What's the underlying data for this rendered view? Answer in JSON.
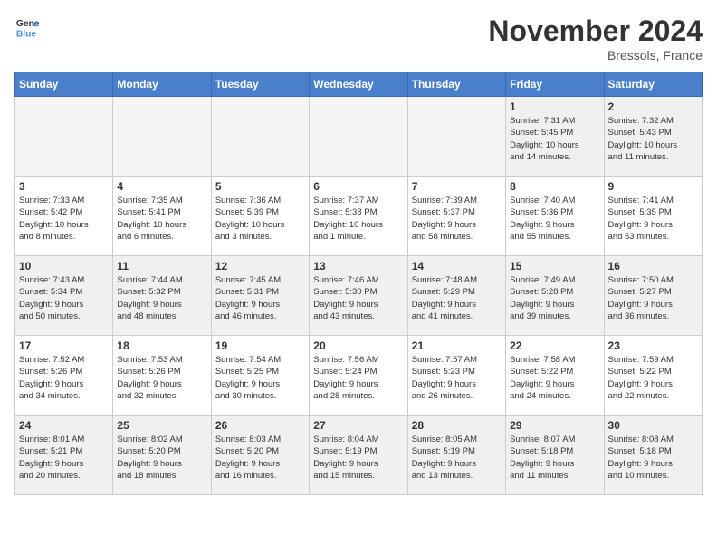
{
  "header": {
    "logo_line1": "General",
    "logo_line2": "Blue",
    "month": "November 2024",
    "location": "Bressols, France"
  },
  "days_of_week": [
    "Sunday",
    "Monday",
    "Tuesday",
    "Wednesday",
    "Thursday",
    "Friday",
    "Saturday"
  ],
  "weeks": [
    [
      {
        "num": "",
        "info": "",
        "empty": true
      },
      {
        "num": "",
        "info": "",
        "empty": true
      },
      {
        "num": "",
        "info": "",
        "empty": true
      },
      {
        "num": "",
        "info": "",
        "empty": true
      },
      {
        "num": "",
        "info": "",
        "empty": true
      },
      {
        "num": "1",
        "info": "Sunrise: 7:31 AM\nSunset: 5:45 PM\nDaylight: 10 hours\nand 14 minutes."
      },
      {
        "num": "2",
        "info": "Sunrise: 7:32 AM\nSunset: 5:43 PM\nDaylight: 10 hours\nand 11 minutes."
      }
    ],
    [
      {
        "num": "3",
        "info": "Sunrise: 7:33 AM\nSunset: 5:42 PM\nDaylight: 10 hours\nand 8 minutes."
      },
      {
        "num": "4",
        "info": "Sunrise: 7:35 AM\nSunset: 5:41 PM\nDaylight: 10 hours\nand 6 minutes."
      },
      {
        "num": "5",
        "info": "Sunrise: 7:36 AM\nSunset: 5:39 PM\nDaylight: 10 hours\nand 3 minutes."
      },
      {
        "num": "6",
        "info": "Sunrise: 7:37 AM\nSunset: 5:38 PM\nDaylight: 10 hours\nand 1 minute."
      },
      {
        "num": "7",
        "info": "Sunrise: 7:39 AM\nSunset: 5:37 PM\nDaylight: 9 hours\nand 58 minutes."
      },
      {
        "num": "8",
        "info": "Sunrise: 7:40 AM\nSunset: 5:36 PM\nDaylight: 9 hours\nand 55 minutes."
      },
      {
        "num": "9",
        "info": "Sunrise: 7:41 AM\nSunset: 5:35 PM\nDaylight: 9 hours\nand 53 minutes."
      }
    ],
    [
      {
        "num": "10",
        "info": "Sunrise: 7:43 AM\nSunset: 5:34 PM\nDaylight: 9 hours\nand 50 minutes."
      },
      {
        "num": "11",
        "info": "Sunrise: 7:44 AM\nSunset: 5:32 PM\nDaylight: 9 hours\nand 48 minutes."
      },
      {
        "num": "12",
        "info": "Sunrise: 7:45 AM\nSunset: 5:31 PM\nDaylight: 9 hours\nand 46 minutes."
      },
      {
        "num": "13",
        "info": "Sunrise: 7:46 AM\nSunset: 5:30 PM\nDaylight: 9 hours\nand 43 minutes."
      },
      {
        "num": "14",
        "info": "Sunrise: 7:48 AM\nSunset: 5:29 PM\nDaylight: 9 hours\nand 41 minutes."
      },
      {
        "num": "15",
        "info": "Sunrise: 7:49 AM\nSunset: 5:28 PM\nDaylight: 9 hours\nand 39 minutes."
      },
      {
        "num": "16",
        "info": "Sunrise: 7:50 AM\nSunset: 5:27 PM\nDaylight: 9 hours\nand 36 minutes."
      }
    ],
    [
      {
        "num": "17",
        "info": "Sunrise: 7:52 AM\nSunset: 5:26 PM\nDaylight: 9 hours\nand 34 minutes."
      },
      {
        "num": "18",
        "info": "Sunrise: 7:53 AM\nSunset: 5:26 PM\nDaylight: 9 hours\nand 32 minutes."
      },
      {
        "num": "19",
        "info": "Sunrise: 7:54 AM\nSunset: 5:25 PM\nDaylight: 9 hours\nand 30 minutes."
      },
      {
        "num": "20",
        "info": "Sunrise: 7:56 AM\nSunset: 5:24 PM\nDaylight: 9 hours\nand 28 minutes."
      },
      {
        "num": "21",
        "info": "Sunrise: 7:57 AM\nSunset: 5:23 PM\nDaylight: 9 hours\nand 26 minutes."
      },
      {
        "num": "22",
        "info": "Sunrise: 7:58 AM\nSunset: 5:22 PM\nDaylight: 9 hours\nand 24 minutes."
      },
      {
        "num": "23",
        "info": "Sunrise: 7:59 AM\nSunset: 5:22 PM\nDaylight: 9 hours\nand 22 minutes."
      }
    ],
    [
      {
        "num": "24",
        "info": "Sunrise: 8:01 AM\nSunset: 5:21 PM\nDaylight: 9 hours\nand 20 minutes."
      },
      {
        "num": "25",
        "info": "Sunrise: 8:02 AM\nSunset: 5:20 PM\nDaylight: 9 hours\nand 18 minutes."
      },
      {
        "num": "26",
        "info": "Sunrise: 8:03 AM\nSunset: 5:20 PM\nDaylight: 9 hours\nand 16 minutes."
      },
      {
        "num": "27",
        "info": "Sunrise: 8:04 AM\nSunset: 5:19 PM\nDaylight: 9 hours\nand 15 minutes."
      },
      {
        "num": "28",
        "info": "Sunrise: 8:05 AM\nSunset: 5:19 PM\nDaylight: 9 hours\nand 13 minutes."
      },
      {
        "num": "29",
        "info": "Sunrise: 8:07 AM\nSunset: 5:18 PM\nDaylight: 9 hours\nand 11 minutes."
      },
      {
        "num": "30",
        "info": "Sunrise: 8:08 AM\nSunset: 5:18 PM\nDaylight: 9 hours\nand 10 minutes."
      }
    ]
  ]
}
